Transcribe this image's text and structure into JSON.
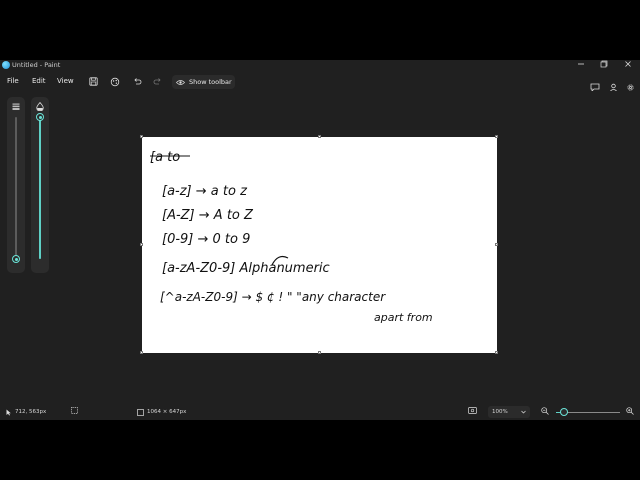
{
  "window": {
    "title": "Untitled - Paint",
    "controls": [
      "minimize",
      "maximize",
      "close"
    ]
  },
  "menu": {
    "file": "File",
    "edit": "Edit",
    "view": "View",
    "show_toolbar": "Show toolbar"
  },
  "sliders": {
    "size_level": 0.0,
    "opacity_level": 1.0
  },
  "canvas": {
    "note_lines": [
      "[a to",
      "[a-z]  → a to z",
      "[A-Z]  → A to Z",
      "[0-9]  → 0 to 9",
      "[a-zA-Z0-9]  Alphanumeric",
      "[^a-zA-Z0-9] → $ ¢ ! \"  \"any character",
      "apart from"
    ]
  },
  "status": {
    "cursor_position": "712, 563px",
    "canvas_size": "1064 × 647px",
    "zoom_level": "100%",
    "zoom_fraction": 0.13
  },
  "colors": {
    "accent": "#5fd1c6",
    "background": "#202020",
    "canvas": "#ffffff"
  }
}
